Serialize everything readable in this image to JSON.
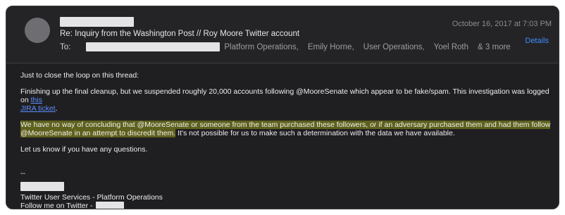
{
  "header": {
    "subject": "Re: Inquiry from the Washington Post // Roy Moore Twitter account",
    "to_label": "To:",
    "recipients": [
      "Platform Operations,",
      "Emily Horne,",
      "User Operations,",
      "Yoel Roth"
    ],
    "more_recipients": "& 3 more",
    "date": "October 16, 2017 at 7:03 PM",
    "details_link": "Details"
  },
  "body": {
    "p1": "Just to close the loop on this thread:",
    "p2_text": "Finishing up the final cleanup, but we suspended roughly 20,000 accounts following @MooreSenate which appear to be fake/spam. This investigation was logged on ",
    "p2_link_a": "this",
    "p2_link_b": "JIRA ticket",
    "p2_end": ".",
    "p3_hl1": "We have no way of concluding that @MooreSenate or someone from the team purchased these followers, ",
    "p3_hl_em": "or",
    "p3_hl2": " if an adversary purchased them and had them follow",
    "p3_hl3": "@MooreSenate in an attempt to discredit them.",
    "p3_rest": " It's not possible for us to make such a determination with the data we have available.",
    "p4": "Let us know if you have any questions."
  },
  "signature": {
    "dash": "--",
    "team": "Twitter User Services - Platform Operations",
    "follow": "Follow me on Twitter -"
  }
}
